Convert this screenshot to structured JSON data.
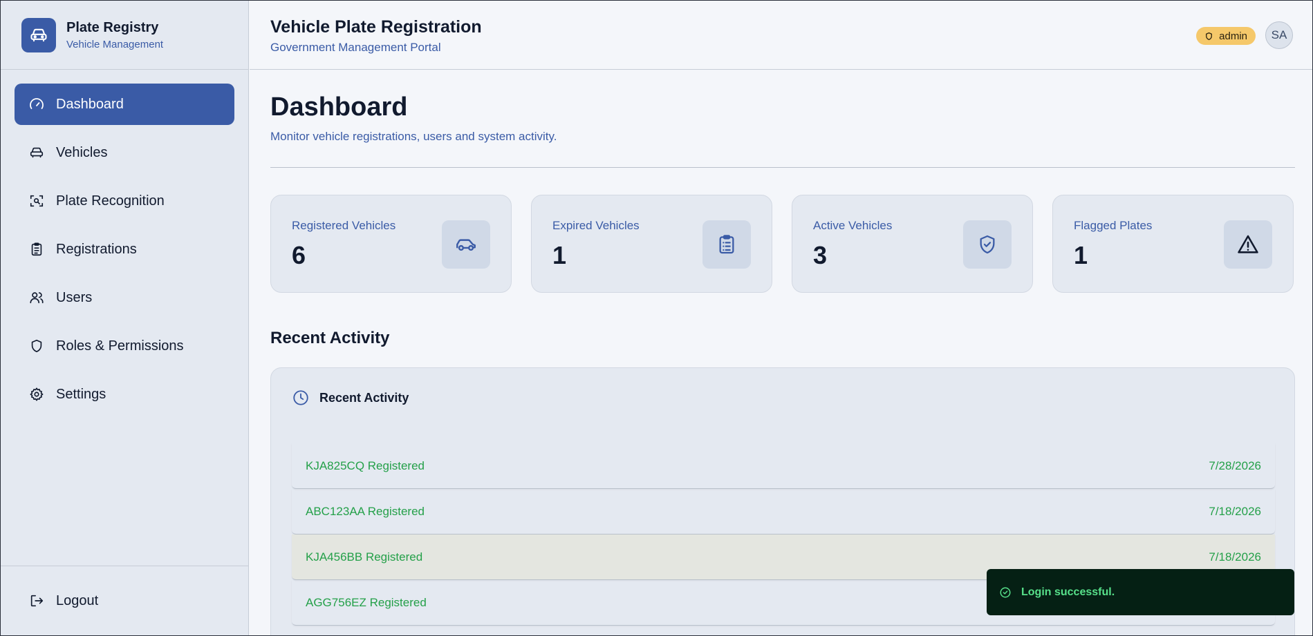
{
  "brand": {
    "title": "Plate Registry",
    "subtitle": "Vehicle Management"
  },
  "nav": {
    "items": [
      {
        "label": "Dashboard",
        "icon": "gauge-icon",
        "active": true
      },
      {
        "label": "Vehicles",
        "icon": "car-icon"
      },
      {
        "label": "Plate Recognition",
        "icon": "scan-icon"
      },
      {
        "label": "Registrations",
        "icon": "clipboard-icon"
      },
      {
        "label": "Users",
        "icon": "users-icon"
      },
      {
        "label": "Roles & Permissions",
        "icon": "shield-icon"
      },
      {
        "label": "Settings",
        "icon": "gear-icon"
      }
    ],
    "logout": "Logout"
  },
  "header": {
    "title": "Vehicle Plate Registration",
    "subtitle": "Government Management Portal",
    "role_badge": "admin",
    "avatar_initials": "SA"
  },
  "page": {
    "title": "Dashboard",
    "subtitle": "Monitor vehicle registrations, users and system activity."
  },
  "stats": [
    {
      "label": "Registered Vehicles",
      "value": "6",
      "icon": "car-icon"
    },
    {
      "label": "Expired Vehicles",
      "value": "1",
      "icon": "clipboard-icon"
    },
    {
      "label": "Active Vehicles",
      "value": "3",
      "icon": "shield-check-icon"
    },
    {
      "label": "Flagged Plates",
      "value": "1",
      "icon": "warning-icon"
    }
  ],
  "activity": {
    "section_title": "Recent Activity",
    "panel_title": "Recent Activity",
    "rows": [
      {
        "text": "KJA825CQ Registered",
        "date": "7/28/2026"
      },
      {
        "text": "ABC123AA Registered",
        "date": "7/18/2026"
      },
      {
        "text": "KJA456BB Registered",
        "date": "7/18/2026"
      },
      {
        "text": "AGG756EZ Registered",
        "date": ""
      }
    ]
  },
  "toast": {
    "message": "Login successful."
  },
  "colors": {
    "accent": "#3a5ba6",
    "success": "#24a049",
    "badge": "#f5c86a",
    "toast_bg": "#052014"
  }
}
